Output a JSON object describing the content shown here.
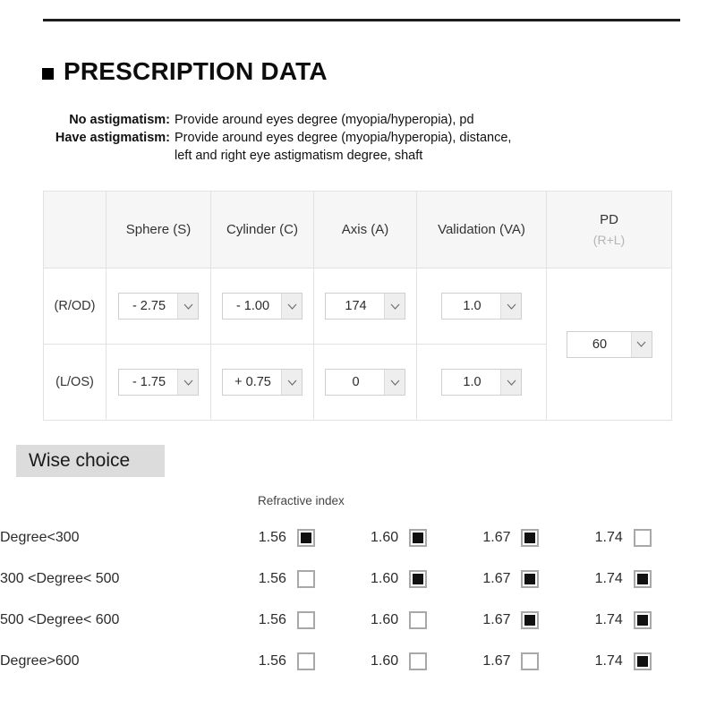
{
  "header": {
    "rule": "horizontal-rule",
    "bullet_icon": "filled-square-bullet-icon",
    "title": "PRESCRIPTION DATA"
  },
  "description": {
    "rows": [
      {
        "label": "No astigmatism:",
        "value": "Provide around eyes degree (myopia/hyperopia), pd"
      },
      {
        "label": "Have astigmatism:",
        "value": "Provide around eyes degree (myopia/hyperopia), distance,",
        "continuation": "left and right eye astigmatism degree, shaft"
      }
    ]
  },
  "prescription_table": {
    "columns": [
      "",
      "Sphere (S)",
      "Cylinder (C)",
      "Axis (A)",
      "Validation (VA)"
    ],
    "pd_column": {
      "main": "PD",
      "sub": "(R+L)"
    },
    "rows": [
      {
        "label": "(R/OD)",
        "sphere": "- 2.75",
        "cylinder": "- 1.00",
        "axis": "174",
        "validation": "1.0"
      },
      {
        "label": "(L/OS)",
        "sphere": "- 1.75",
        "cylinder": "+ 0.75",
        "axis": "0",
        "validation": "1.0"
      }
    ],
    "pd_value": "60",
    "dropdown_arrow_icon": "chevron-down-icon"
  },
  "wise_choice": {
    "heading": "Wise choice",
    "refractive_index_label": "Refractive index",
    "index_options": [
      "1.56",
      "1.60",
      "1.67",
      "1.74"
    ],
    "rows": [
      {
        "label": "Degree<300",
        "checked": [
          true,
          true,
          true,
          false
        ]
      },
      {
        "label": "300 <Degree< 500",
        "checked": [
          false,
          true,
          true,
          true
        ]
      },
      {
        "label": "500 <Degree< 600",
        "checked": [
          false,
          false,
          true,
          true
        ]
      },
      {
        "label": "Degree>600",
        "checked": [
          false,
          false,
          false,
          true
        ]
      }
    ]
  },
  "colors": {
    "page_background": "#ffffff",
    "rule": "#1c1c1c",
    "table_border": "#e2e2e2",
    "table_header_bg": "#f6f6f6",
    "pd_sub_text": "#b5b5b5",
    "select_border": "#cfcfcf",
    "select_arrow_bg": "#eeeeee",
    "wise_heading_bg": "#dcdcdc",
    "checkbox_border": "#a8a8a8",
    "checkbox_fill": "#111111"
  }
}
